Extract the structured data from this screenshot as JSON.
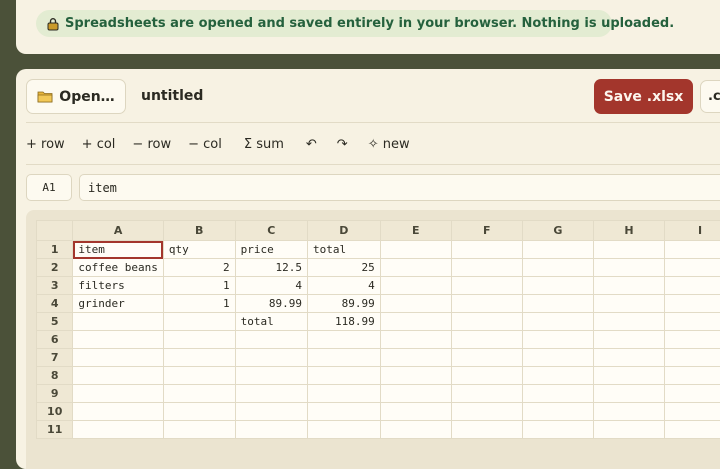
{
  "notice": {
    "text": "Spreadsheets are opened and saved entirely in your browser. Nothing is uploaded.",
    "icon": "lock-icon"
  },
  "toolbar": {
    "open_label": "Open…",
    "doc_title": "untitled",
    "save_label": "Save .xlsx",
    "csv_label": ".cs",
    "accent_color": "#a3362c"
  },
  "actions": [
    {
      "label": "+ row"
    },
    {
      "label": "+ col"
    },
    {
      "label": "− row"
    },
    {
      "label": "− col"
    },
    {
      "label": "Σ sum"
    },
    {
      "label": "↶"
    },
    {
      "label": "↷"
    },
    {
      "label": "✧ new"
    }
  ],
  "cellbar": {
    "ref": "A1",
    "value": "item"
  },
  "grid": {
    "columns": [
      "A",
      "B",
      "C",
      "D",
      "E",
      "F",
      "G",
      "H",
      "I"
    ],
    "rows": [
      {
        "n": "1",
        "cells": [
          "item",
          "qty",
          "price",
          "total",
          "",
          "",
          "",
          "",
          ""
        ]
      },
      {
        "n": "2",
        "cells": [
          "coffee beans",
          "2",
          "12.5",
          "25",
          "",
          "",
          "",
          "",
          ""
        ]
      },
      {
        "n": "3",
        "cells": [
          "filters",
          "1",
          "4",
          "4",
          "",
          "",
          "",
          "",
          ""
        ]
      },
      {
        "n": "4",
        "cells": [
          "grinder",
          "1",
          "89.99",
          "89.99",
          "",
          "",
          "",
          "",
          ""
        ]
      },
      {
        "n": "5",
        "cells": [
          "",
          "",
          "total",
          "118.99",
          "",
          "",
          "",
          "",
          ""
        ]
      },
      {
        "n": "6",
        "cells": [
          "",
          "",
          "",
          "",
          "",
          "",
          "",
          "",
          ""
        ]
      },
      {
        "n": "7",
        "cells": [
          "",
          "",
          "",
          "",
          "",
          "",
          "",
          "",
          ""
        ]
      },
      {
        "n": "8",
        "cells": [
          "",
          "",
          "",
          "",
          "",
          "",
          "",
          "",
          ""
        ]
      },
      {
        "n": "9",
        "cells": [
          "",
          "",
          "",
          "",
          "",
          "",
          "",
          "",
          ""
        ]
      },
      {
        "n": "10",
        "cells": [
          "",
          "",
          "",
          "",
          "",
          "",
          "",
          "",
          ""
        ]
      },
      {
        "n": "11",
        "cells": [
          "",
          "",
          "",
          "",
          "",
          "",
          "",
          "",
          ""
        ]
      }
    ],
    "selected": "A1"
  }
}
